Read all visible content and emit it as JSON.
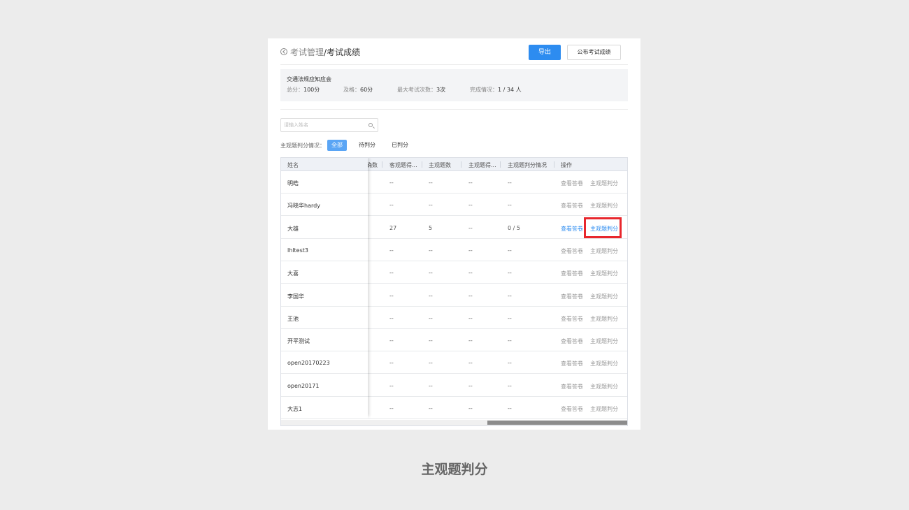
{
  "breadcrumb": {
    "parent": "考试管理",
    "separator": "/",
    "current": "考试成绩"
  },
  "header": {
    "export_label": "导出",
    "publish_label": "公布考试成绩"
  },
  "info": {
    "title": "交通法规应知应会",
    "total_label": "总分：",
    "total_value": "100分",
    "pass_label": "及格：",
    "pass_value": "60分",
    "max_label": "最大考试次数：",
    "max_value": "3次",
    "done_label": "完成情况：",
    "done_value": "1 / 34 人"
  },
  "search": {
    "placeholder": "请输入姓名",
    "icon": "search-icon"
  },
  "filter": {
    "label": "主观题判分情况：",
    "options": [
      "全部",
      "待判分",
      "已判分"
    ],
    "active": "全部"
  },
  "table": {
    "columns": [
      "姓名",
      "确数",
      "客观题得...",
      "主观题数",
      "主观题得...",
      "主观题判分情况",
      "操作"
    ],
    "rows": [
      {
        "name": "明皓",
        "obj": "--",
        "subj_count": "--",
        "subj_score": "--",
        "status": "--",
        "view": "查看答卷",
        "grade": "主观题判分"
      },
      {
        "name": "冯晓华hardy",
        "obj": "--",
        "subj_count": "--",
        "subj_score": "--",
        "status": "--",
        "view": "查看答卷",
        "grade": "主观题判分"
      },
      {
        "name": "大雄",
        "obj": "27",
        "subj_count": "5",
        "subj_score": "--",
        "status": "0 / 5",
        "view": "查看答卷",
        "grade": "主观题判分"
      },
      {
        "name": "lhltest3",
        "obj": "--",
        "subj_count": "--",
        "subj_score": "--",
        "status": "--",
        "view": "查看答卷",
        "grade": "主观题判分"
      },
      {
        "name": "大喜",
        "obj": "--",
        "subj_count": "--",
        "subj_score": "--",
        "status": "--",
        "view": "查看答卷",
        "grade": "主观题判分"
      },
      {
        "name": "李国华",
        "obj": "--",
        "subj_count": "--",
        "subj_score": "--",
        "status": "--",
        "view": "查看答卷",
        "grade": "主观题判分"
      },
      {
        "name": "王池",
        "obj": "--",
        "subj_count": "--",
        "subj_score": "--",
        "status": "--",
        "view": "查看答卷",
        "grade": "主观题判分"
      },
      {
        "name": "开平测试",
        "obj": "--",
        "subj_count": "--",
        "subj_score": "--",
        "status": "--",
        "view": "查看答卷",
        "grade": "主观题判分"
      },
      {
        "name": "open20170223",
        "obj": "--",
        "subj_count": "--",
        "subj_score": "--",
        "status": "--",
        "view": "查看答卷",
        "grade": "主观题判分"
      },
      {
        "name": "open20171",
        "obj": "--",
        "subj_count": "--",
        "subj_score": "--",
        "status": "--",
        "view": "查看答卷",
        "grade": "主观题判分"
      },
      {
        "name": "大志1",
        "obj": "--",
        "subj_count": "--",
        "subj_score": "--",
        "status": "--",
        "view": "查看答卷",
        "grade": "主观题判分"
      }
    ]
  },
  "colors": {
    "primary": "#2d8cf0",
    "highlight": "#e8272d"
  },
  "caption": "主观题判分"
}
